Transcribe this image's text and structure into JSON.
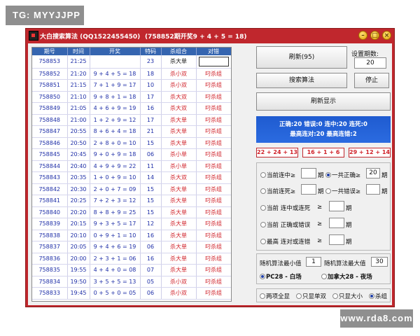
{
  "watermarks": {
    "top_left": "TG: MYYJJPP",
    "bottom_right": "www.rda8.com"
  },
  "window": {
    "title": "大白搜索算法 (QQ1522455450)",
    "issue_info": "(758852期开奖9 + 4 + 5 = 18)",
    "btn_minimize": "–",
    "btn_maximize": "□",
    "btn_close": "×"
  },
  "table": {
    "headers": [
      "期号",
      "时间",
      "开奖",
      "特码",
      "杀组合",
      "对错"
    ],
    "rows": [
      {
        "id": "758853",
        "time": "21:25",
        "draw": "",
        "code": "23",
        "kill": "杀大单",
        "result": ""
      },
      {
        "id": "758852",
        "time": "21:20",
        "draw": "9 + 4 + 5 = 18",
        "code": "18",
        "kill": "杀小双",
        "result": "叼杀组"
      },
      {
        "id": "758851",
        "time": "21:15",
        "draw": "7 + 1 + 9 = 17",
        "code": "10",
        "kill": "杀小双",
        "result": "叼杀组"
      },
      {
        "id": "758850",
        "time": "21:10",
        "draw": "9 + 8 + 1 = 18",
        "code": "17",
        "kill": "杀大双",
        "result": "叼杀组"
      },
      {
        "id": "758849",
        "time": "21:05",
        "draw": "4 + 6 + 9 = 19",
        "code": "16",
        "kill": "杀大双",
        "result": "叼杀组"
      },
      {
        "id": "758848",
        "time": "21:00",
        "draw": "1 + 2 + 9 = 12",
        "code": "17",
        "kill": "杀大单",
        "result": "叼杀组"
      },
      {
        "id": "758847",
        "time": "20:55",
        "draw": "8 + 6 + 4 = 18",
        "code": "21",
        "kill": "杀大单",
        "result": "叼杀组"
      },
      {
        "id": "758846",
        "time": "20:50",
        "draw": "2 + 8 + 0 = 10",
        "code": "15",
        "kill": "杀大单",
        "result": "叼杀组"
      },
      {
        "id": "758845",
        "time": "20:45",
        "draw": "9 + 0 + 9 = 18",
        "code": "06",
        "kill": "杀小单",
        "result": "叼杀组"
      },
      {
        "id": "758844",
        "time": "20:40",
        "draw": "4 + 9 + 9 = 22",
        "code": "11",
        "kill": "杀小单",
        "result": "叼杀组"
      },
      {
        "id": "758843",
        "time": "20:35",
        "draw": "1 + 0 + 9 = 10",
        "code": "14",
        "kill": "杀大双",
        "result": "叼杀组"
      },
      {
        "id": "758842",
        "time": "20:30",
        "draw": "2 + 0 + 7 = 09",
        "code": "15",
        "kill": "杀大单",
        "result": "叼杀组"
      },
      {
        "id": "758841",
        "time": "20:25",
        "draw": "7 + 2 + 3 = 12",
        "code": "15",
        "kill": "杀大单",
        "result": "叼杀组"
      },
      {
        "id": "758840",
        "time": "20:20",
        "draw": "8 + 8 + 9 = 25",
        "code": "15",
        "kill": "杀大单",
        "result": "叼杀组"
      },
      {
        "id": "758839",
        "time": "20:15",
        "draw": "9 + 3 + 5 = 17",
        "code": "12",
        "kill": "杀大单",
        "result": "叼杀组"
      },
      {
        "id": "758838",
        "time": "20:10",
        "draw": "0 + 9 + 1 = 10",
        "code": "16",
        "kill": "杀大单",
        "result": "叼杀组"
      },
      {
        "id": "758837",
        "time": "20:05",
        "draw": "9 + 4 + 6 = 19",
        "code": "06",
        "kill": "杀大单",
        "result": "叼杀组"
      },
      {
        "id": "758836",
        "time": "20:00",
        "draw": "2 + 3 + 1 = 06",
        "code": "16",
        "kill": "杀大单",
        "result": "叼杀组"
      },
      {
        "id": "758835",
        "time": "19:55",
        "draw": "4 + 4 + 0 = 08",
        "code": "07",
        "kill": "杀大单",
        "result": "叼杀组"
      },
      {
        "id": "758834",
        "time": "19:50",
        "draw": "3 + 5 + 5 = 13",
        "code": "05",
        "kill": "杀小双",
        "result": "叼杀组"
      },
      {
        "id": "758833",
        "time": "19:45",
        "draw": "0 + 5 + 0 = 05",
        "code": "06",
        "kill": "杀小双",
        "result": "叼杀组"
      }
    ]
  },
  "controls": {
    "refresh_btn": "刷新(95)",
    "period_label": "设置期数:",
    "period_value": "20",
    "search_btn": "搜索算法",
    "stop_btn": "停止",
    "refresh_display_btn": "刷新显示"
  },
  "stats": {
    "line1": "正确:20 错误:0 连中:20 连死:0",
    "line2": "最高连对:20 最高连错:2"
  },
  "formulas": [
    "22 + 24 + 13",
    "16 + 1 + 6",
    "29 + 12 + 14"
  ],
  "filters": {
    "current_streak_win": "当前连中≥",
    "unit": "期",
    "total_correct": "一共正确≥",
    "total_correct_value": "20",
    "current_streak_lose": "当前连死≥",
    "total_wrong": "一共错误≥",
    "win_or_streak_lose": "当前 连中或连死",
    "correct_or_wrong": "当前 正确或错误",
    "max_pair_or_wrong": "最高 连对或连错",
    "ge": "≥"
  },
  "random": {
    "min_label": "随机算法最小值",
    "min_value": "1",
    "max_label": "随机算法最大值",
    "max_value": "30",
    "opt1": "PC28 - 白场",
    "opt2": "加拿大28 - 夜场"
  },
  "bottom_options": [
    "两项全显",
    "只显单双",
    "只显大小",
    "杀组"
  ]
}
